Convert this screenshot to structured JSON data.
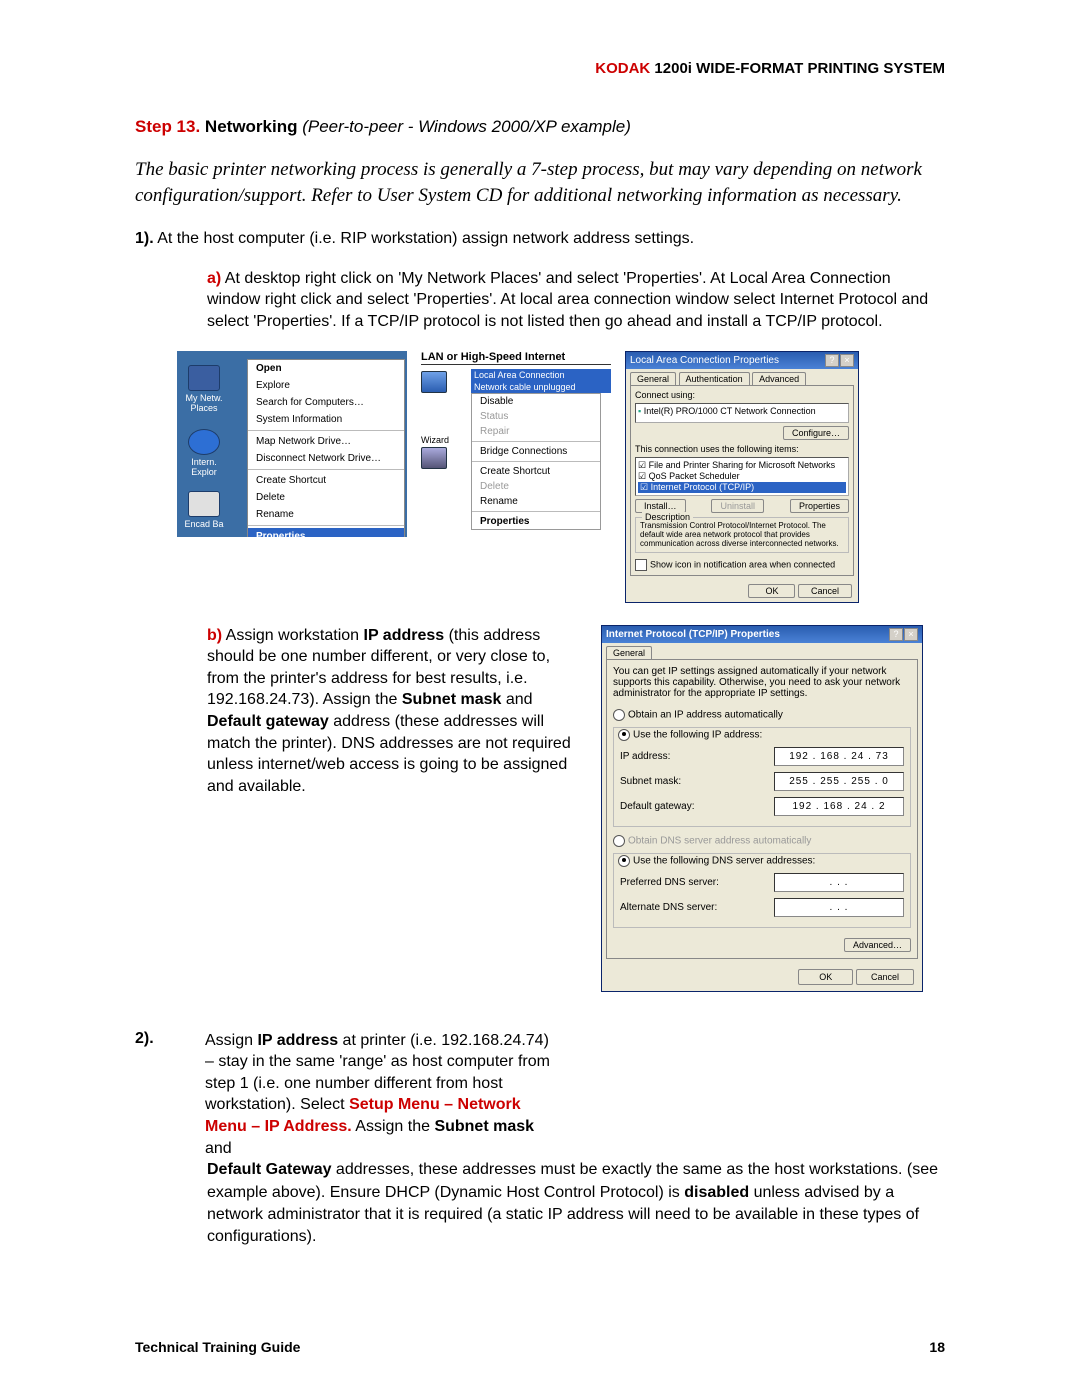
{
  "header": {
    "brand": "KODAK",
    "rest": " 1200i WIDE-FORMAT PRINTING SYSTEM"
  },
  "step": {
    "num": "Step 13.",
    "title_bold": " Networking",
    "title_italic": " (Peer-to-peer - Windows 2000/XP example)"
  },
  "intro": "The basic printer networking process is generally a 7-step process, but may vary depending on network configuration/support. Refer to User System CD for additional networking information as necessary.",
  "p1_label": "1).",
  "p1_text": " At the host computer (i.e. RIP workstation) assign network address settings.",
  "sub_a_label": "a)",
  "sub_a_text": " At desktop right click on 'My Network Places' and select 'Properties'. At Local Area Connection window right click and select 'Properties'. At local area connection window select Internet Protocol and select 'Properties'. If a TCP/IP protocol is not listed then go ahead and install a TCP/IP protocol.",
  "fig1": {
    "icon1": "My Netw. Places",
    "icon2": "Intern. Explor",
    "icon3": "Encad Ba",
    "ctx": [
      "Open",
      "Explore",
      "Search for Computers…",
      "System Information",
      "Map Network Drive…",
      "Disconnect Network Drive…",
      "Create Shortcut",
      "Delete",
      "Rename",
      "Properties"
    ],
    "open_idx": 0,
    "props_idx": 9,
    "hr_after": [
      3,
      5,
      8
    ]
  },
  "fig2": {
    "header": "LAN or High-Speed Internet",
    "sel1": "Local Area Connection",
    "sel2": "Network cable unplugged",
    "wiz": "Wizard",
    "ctx": [
      "Disable",
      "Status",
      "Repair",
      "Bridge Connections",
      "Create Shortcut",
      "Delete",
      "Rename",
      "Properties"
    ],
    "dim_idx": [
      1,
      2,
      5
    ],
    "bold_idx": 7,
    "hr_after": [
      2,
      3,
      6
    ]
  },
  "fig3": {
    "title": "Local Area Connection Properties",
    "tabs": [
      "General",
      "Authentication",
      "Advanced"
    ],
    "connect_using_label": "Connect using:",
    "adapter": "Intel(R) PRO/1000 CT Network Connection",
    "configure": "Configure…",
    "uses_label": "This connection uses the following items:",
    "items": [
      "File and Printer Sharing for Microsoft Networks",
      "QoS Packet Scheduler",
      "Internet Protocol (TCP/IP)"
    ],
    "install": "Install…",
    "uninstall": "Uninstall",
    "properties": "Properties",
    "desc_legend": "Description",
    "desc": "Transmission Control Protocol/Internet Protocol. The default wide area network protocol that provides communication across diverse interconnected networks.",
    "show_icon": "Show icon in notification area when connected",
    "ok": "OK",
    "cancel": "Cancel"
  },
  "section_b": {
    "label": "b)",
    "t1": " Assign workstation ",
    "b1": "IP address",
    "t2": " (this address should be one number different, or very close to, from the printer's address for best results, i.e. 192.168.24.73). Assign the ",
    "b2": "Subnet mask",
    "t3": " and ",
    "b3": "Default gateway",
    "t4": " address (these addresses will match the printer). DNS addresses are not required unless internet/web access is going to be assigned and available."
  },
  "fig4": {
    "title": "Internet Protocol (TCP/IP) Properties",
    "tab": "General",
    "info": "You can get IP settings assigned automatically if your network supports this capability. Otherwise, you need to ask your network administrator for the appropriate IP settings.",
    "r1": "Obtain an IP address automatically",
    "r2": "Use the following IP address:",
    "ip_label": "IP address:",
    "ip_val": "192 . 168 .  24  .  73",
    "sm_label": "Subnet mask:",
    "sm_val": "255 . 255 . 255 .   0",
    "gw_label": "Default gateway:",
    "gw_val": "192 . 168 .  24  .   2",
    "r3": "Obtain DNS server address automatically",
    "r4": "Use the following DNS server addresses:",
    "dns1_label": "Preferred DNS server:",
    "dns1_val": ".       .       .",
    "dns2_label": "Alternate DNS server:",
    "dns2_val": ".       .       .",
    "advanced": "Advanced…",
    "ok": "OK",
    "cancel": "Cancel"
  },
  "section_2": {
    "label": "2).",
    "t1": "Assign ",
    "b1": "IP address",
    "t2": " at printer (i.e. 192.168.24.74) – stay in the same 'range' as host computer from step 1 (i.e. one number different from host workstation). Select ",
    "r1": "Setup Menu – Network Menu – IP Address.",
    "t3": " Assign the ",
    "b2": "Subnet mask",
    "t4": " and"
  },
  "cont": {
    "b1": "Default Gateway",
    "t1": " addresses, these addresses must be exactly the same as the host workstations. (see example above). Ensure DHCP (Dynamic Host Control Protocol) is ",
    "b2": "disabled",
    "t2": " unless advised by a network administrator that it is required (a static IP address will need to be available in these types of configurations)."
  },
  "footer": {
    "left": "Technical Training Guide",
    "right": "18"
  }
}
